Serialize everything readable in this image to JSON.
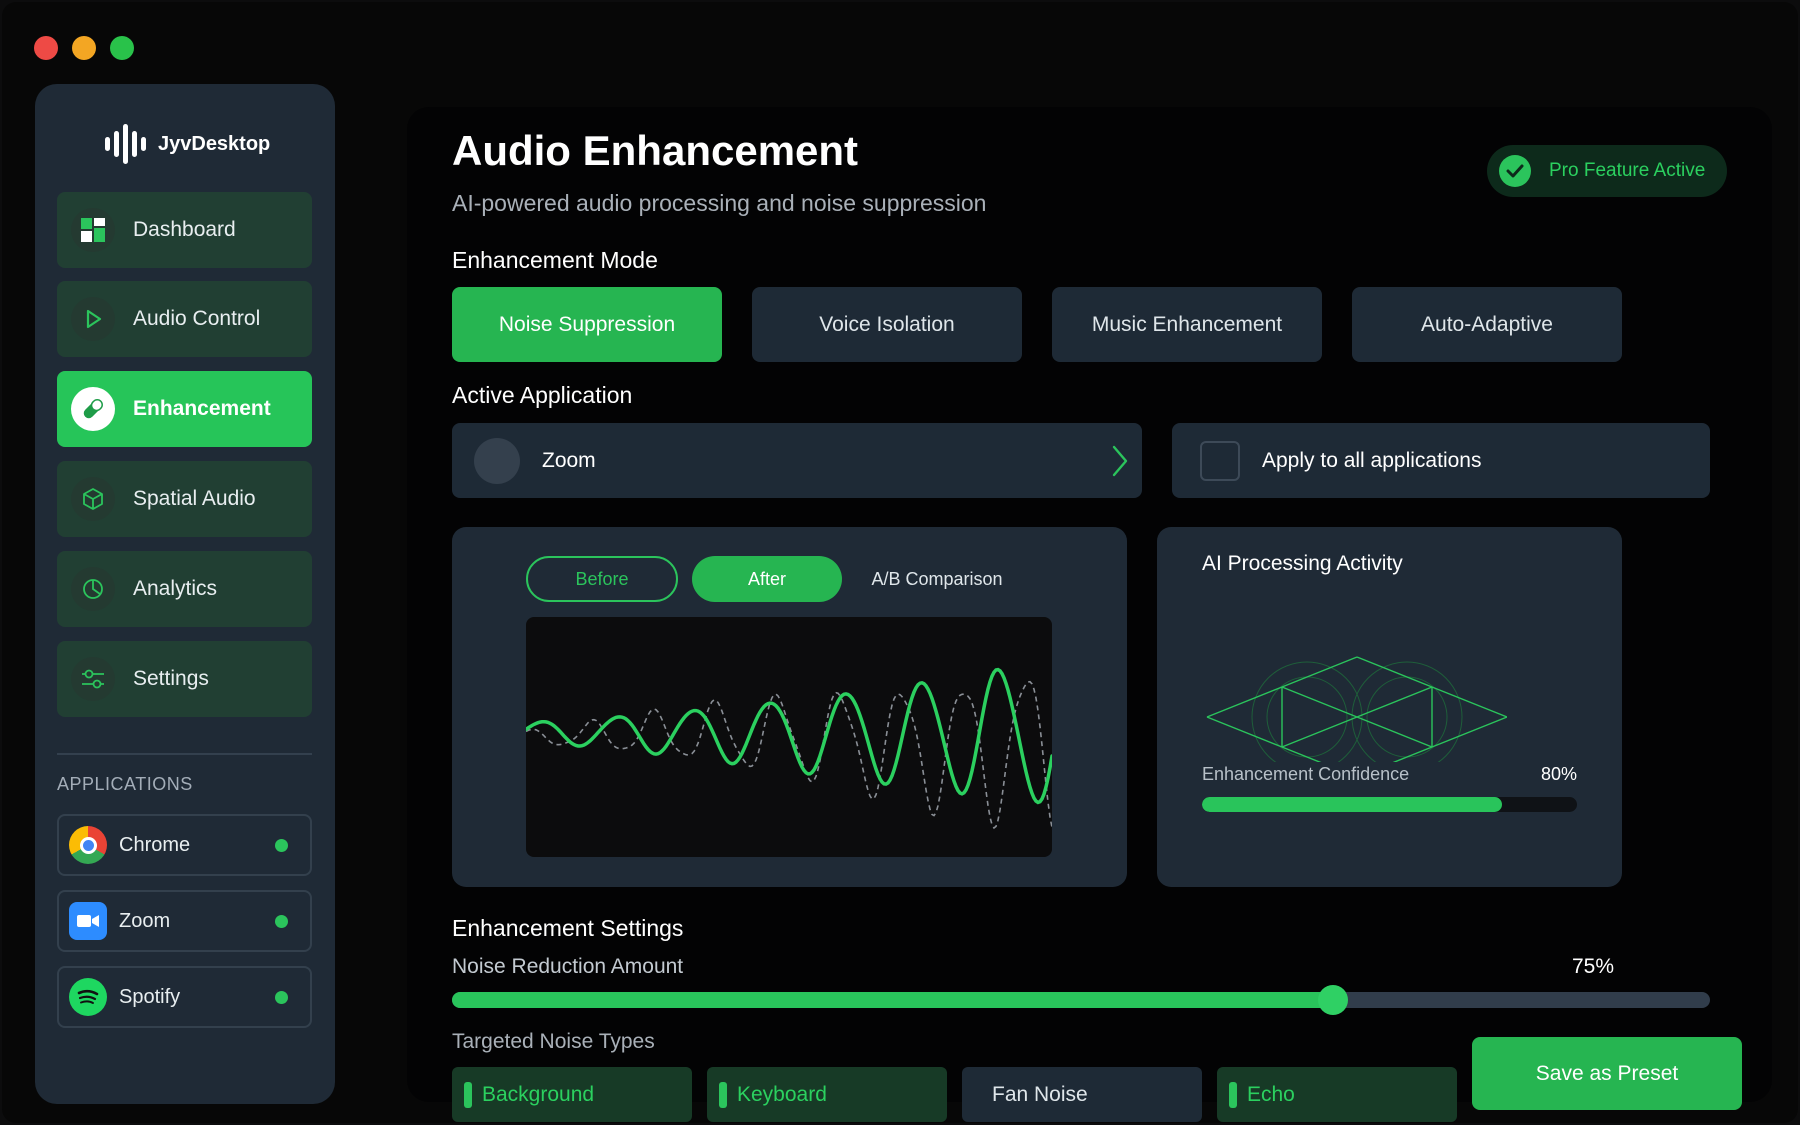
{
  "brand": {
    "name": "JyvDesktop",
    "accent": "#26c559"
  },
  "sidebar": {
    "items": [
      {
        "label": "Dashboard",
        "icon": "dashboard-icon"
      },
      {
        "label": "Audio Control",
        "icon": "play-icon"
      },
      {
        "label": "Enhancement",
        "icon": "pill-icon",
        "active": true
      },
      {
        "label": "Spatial Audio",
        "icon": "cube-icon"
      },
      {
        "label": "Analytics",
        "icon": "pie-chart-icon"
      },
      {
        "label": "Settings",
        "icon": "sliders-icon"
      }
    ],
    "apps_heading": "APPLICATIONS",
    "apps": [
      {
        "label": "Chrome",
        "icon": "chrome-icon",
        "status": "active"
      },
      {
        "label": "Zoom",
        "icon": "zoom-icon",
        "status": "active"
      },
      {
        "label": "Spotify",
        "icon": "spotify-icon",
        "status": "active"
      }
    ]
  },
  "header": {
    "title": "Audio Enhancement",
    "subtitle": "AI-powered audio processing and noise suppression",
    "badge": "Pro Feature Active"
  },
  "mode": {
    "label": "Enhancement Mode",
    "options": [
      "Noise Suppression",
      "Voice Isolation",
      "Music Enhancement",
      "Auto-Adaptive"
    ],
    "selected": "Noise Suppression"
  },
  "application": {
    "label": "Active Application",
    "selected": "Zoom",
    "apply_all_label": "Apply to all applications",
    "apply_all_checked": false
  },
  "comparison": {
    "before_label": "Before",
    "after_label": "After",
    "ab_label": "A/B Comparison",
    "selected": "After"
  },
  "ai": {
    "title": "AI Processing Activity",
    "confidence_label": "Enhancement Confidence",
    "confidence_value": "80%",
    "confidence_fraction": 0.8
  },
  "settings": {
    "label": "Enhancement Settings",
    "noise_reduction_label": "Noise Reduction Amount",
    "noise_reduction_value": "75%",
    "noise_reduction_fraction": 0.7,
    "noise_types_label": "Targeted Noise Types",
    "noise_types": [
      {
        "label": "Background",
        "selected": true
      },
      {
        "label": "Keyboard",
        "selected": true
      },
      {
        "label": "Fan Noise",
        "selected": false
      },
      {
        "label": "Echo",
        "selected": true
      }
    ],
    "save_label": "Save as Preset"
  }
}
